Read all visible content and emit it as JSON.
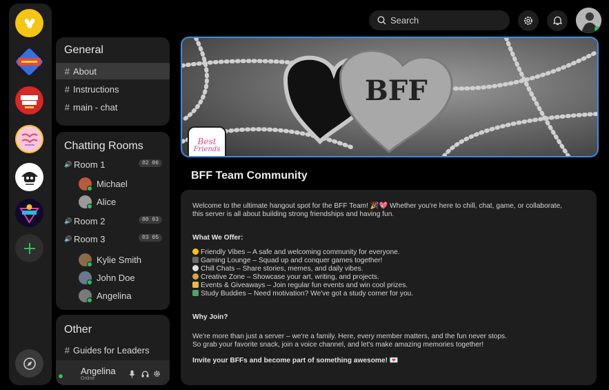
{
  "servers": [
    {
      "name": "bee-logo",
      "color": "#f5c518"
    },
    {
      "name": "comedy-club-logo"
    },
    {
      "name": "comic-book-club-logo"
    },
    {
      "name": "best-friends-logo"
    },
    {
      "name": "gaming-robot-logo"
    },
    {
      "name": "gaming-neon-logo"
    },
    {
      "name": "add-server",
      "icon": "plus-icon",
      "color": "#2fbf5b"
    },
    {
      "name": "explore",
      "icon": "compass-icon"
    }
  ],
  "general": {
    "title": "General",
    "channels": [
      {
        "label": "About",
        "active": true
      },
      {
        "label": "Instructions"
      },
      {
        "label": "main - chat"
      }
    ]
  },
  "chatting": {
    "title": "Chatting Rooms",
    "rooms": [
      {
        "label": "Room 1",
        "badge": "02 06",
        "members": [
          "Michael",
          "Alice"
        ]
      },
      {
        "label": "Room 2",
        "badge": "00 03",
        "members": []
      },
      {
        "label": "Room 3",
        "badge": "03 05",
        "members": [
          "Kylie Smith",
          "John Doe",
          "Angelina"
        ]
      }
    ]
  },
  "other": {
    "title": "Other",
    "channels": [
      {
        "label": "Guides for Leaders"
      }
    ]
  },
  "user": {
    "name": "Angelina",
    "status": "Online"
  },
  "search": {
    "placeholder": "Search"
  },
  "banner": {
    "text": "BFF"
  },
  "server_icon": {
    "line1": "Best",
    "line2": "Friends"
  },
  "community": {
    "title": "BFF Team Community"
  },
  "content": {
    "intro1": "Welcome to the ultimate hangout spot for the BFF Team! 🎉💖 Whether you're here to chill, chat, game, or collaborate,",
    "intro2": "this server is all about building strong friendships and having fun.",
    "offer_heading": "What We Offer:",
    "offers": [
      "Friendly Vibes – A safe and welcoming community for everyone.",
      "Gaming Lounge – Squad up and conquer games together!",
      "Chill Chats – Share stories, memes, and daily vibes.",
      "Creative Zone – Showcase your art, writing, and projects.",
      "Events & Giveaways – Join regular fun events and win cool prizes.",
      "Study Buddies – Need motivation? We've got a study corner for you."
    ],
    "offer_icon_colors": [
      "#f5c518",
      "#6a6a6a",
      "#e0e0e0",
      "#d9a441",
      "#e8b84a",
      "#4fa36b"
    ],
    "why_heading": "Why Join?",
    "why1": "We're more than just a server – we're a family. Here, every member matters, and the fun never stops.",
    "why2": "So grab your favorite snack, join a voice channel, and let's make amazing memories together!",
    "invite": "Invite your BFFs and become part of something awesome! 💌"
  }
}
